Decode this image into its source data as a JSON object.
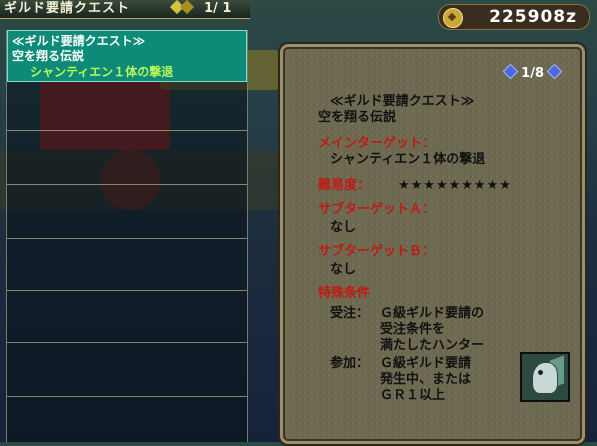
{
  "header": {
    "title": "ギルド要請クエスト",
    "count": "1/ 1"
  },
  "money": {
    "amount": "225908z",
    "icon": "coin-icon"
  },
  "list": {
    "selected": {
      "category": "≪ギルド要請クエスト≫",
      "name": "空を翔る伝説",
      "objective": "シャンティエン１体の撃退"
    }
  },
  "detail": {
    "page": "1/8",
    "category": "≪ギルド要請クエスト≫",
    "name": "空を翔る伝説",
    "main_target_label": "メインターゲット：",
    "main_target": "シャンティエン１体の撃退",
    "difficulty_label": "難易度：",
    "difficulty_stars": "★★★★★★★★★",
    "sub_a_label": "サブターゲットＡ：",
    "sub_a": "なし",
    "sub_b_label": "サブターゲットＢ：",
    "sub_b": "なし",
    "special_label": "特殊条件",
    "accept_label": "受注：",
    "accept_1": "Ｇ級ギルド要請の",
    "accept_2": "受注条件を",
    "accept_3": "満たしたハンター",
    "join_label": "参加：",
    "join_1": "Ｇ級ギルド要請",
    "join_2": "発生中、または",
    "join_3": "ＧＲ１以上"
  },
  "colors": {
    "accent": "#0e8a78",
    "label_red": "#c01a14",
    "highlight_text": "#b8f858"
  }
}
